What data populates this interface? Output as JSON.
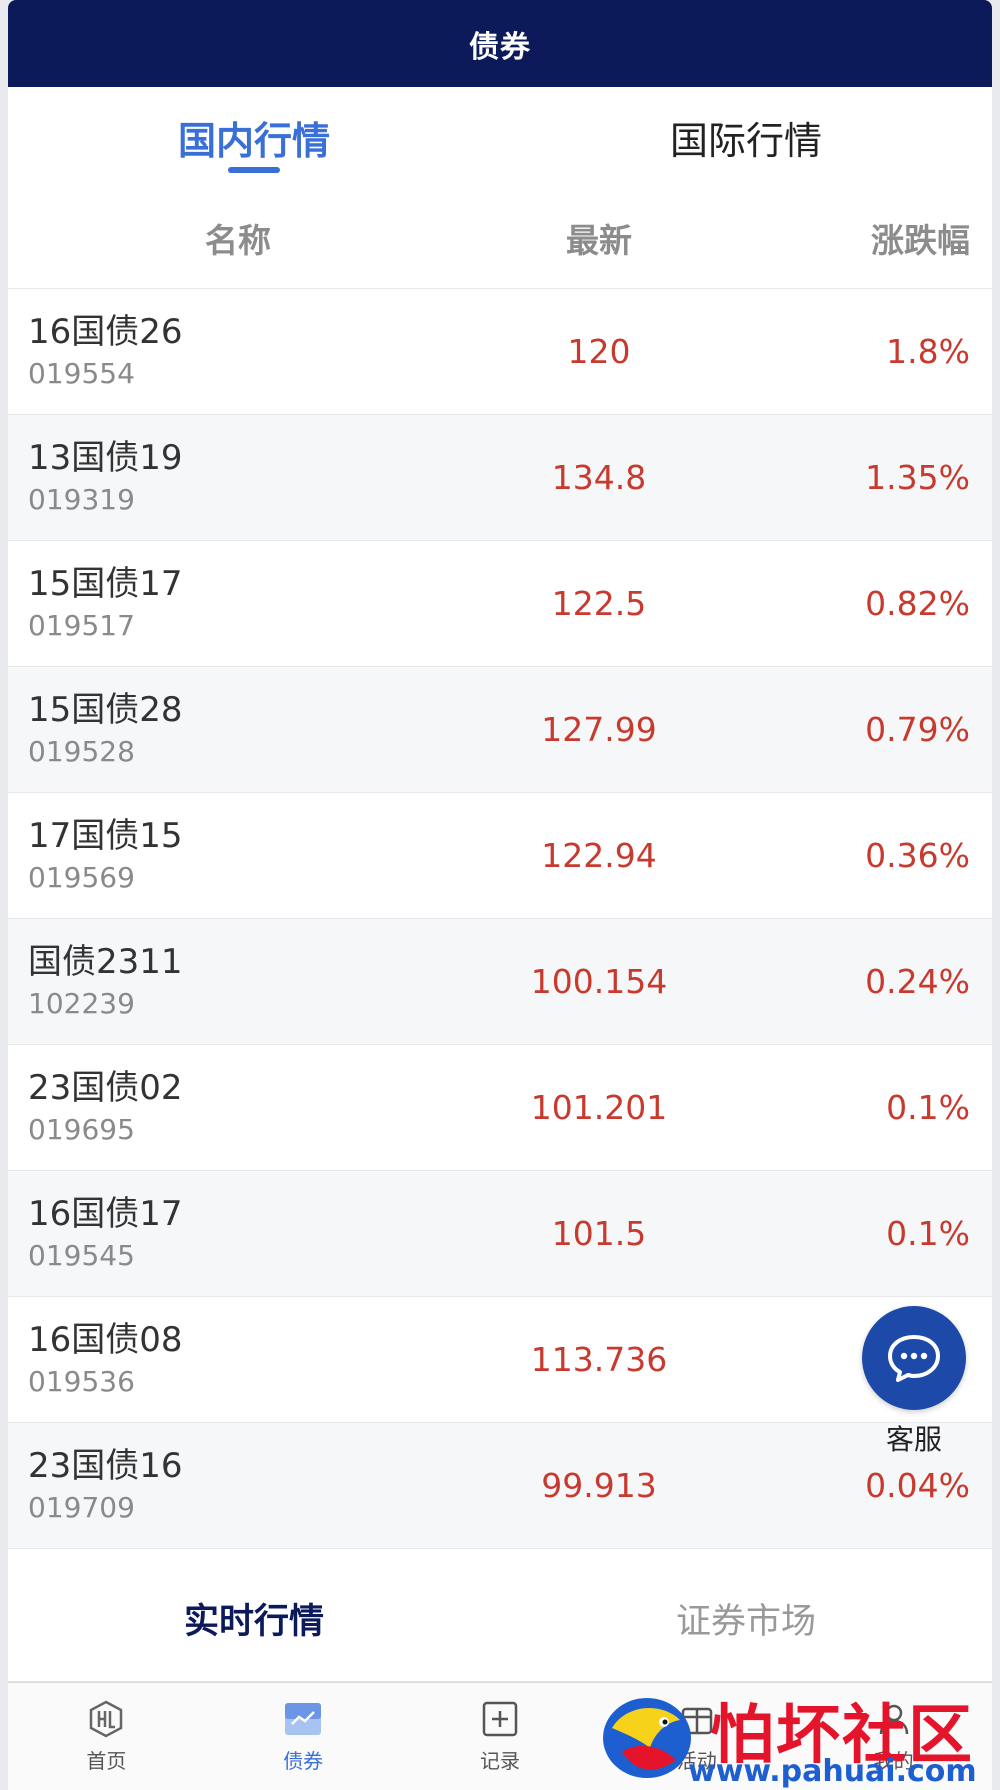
{
  "header": {
    "title": "债券"
  },
  "tabs": [
    {
      "label": "国内行情",
      "active": true
    },
    {
      "label": "国际行情",
      "active": false
    }
  ],
  "columns": {
    "name": "名称",
    "price": "最新",
    "change": "涨跌幅"
  },
  "rows": [
    {
      "name": "16国债26",
      "code": "019554",
      "price": "120",
      "change": "1.8%"
    },
    {
      "name": "13国债19",
      "code": "019319",
      "price": "134.8",
      "change": "1.35%"
    },
    {
      "name": "15国债17",
      "code": "019517",
      "price": "122.5",
      "change": "0.82%"
    },
    {
      "name": "15国债28",
      "code": "019528",
      "price": "127.99",
      "change": "0.79%"
    },
    {
      "name": "17国债15",
      "code": "019569",
      "price": "122.94",
      "change": "0.36%"
    },
    {
      "name": "国债2311",
      "code": "102239",
      "price": "100.154",
      "change": "0.24%"
    },
    {
      "name": "23国债02",
      "code": "019695",
      "price": "101.201",
      "change": "0.1%"
    },
    {
      "name": "16国债17",
      "code": "019545",
      "price": "101.5",
      "change": "0.1%"
    },
    {
      "name": "16国债08",
      "code": "019536",
      "price": "113.736",
      "change": ""
    },
    {
      "name": "23国债16",
      "code": "019709",
      "price": "99.913",
      "change": "0.04%"
    }
  ],
  "float_service": {
    "label": "客服",
    "icon": "chat-bubble-icon"
  },
  "subtabs": [
    {
      "label": "实时行情",
      "active": true
    },
    {
      "label": "证券市场",
      "active": false
    }
  ],
  "bottom_nav": [
    {
      "label": "首页",
      "icon": "hl-logo-icon",
      "active": false
    },
    {
      "label": "债券",
      "icon": "trend-chart-icon",
      "active": true
    },
    {
      "label": "记录",
      "icon": "plus-square-icon",
      "active": false
    },
    {
      "label": "活动",
      "icon": "activity-icon",
      "active": false
    },
    {
      "label": "我的",
      "icon": "user-icon",
      "active": false
    }
  ],
  "watermark": {
    "title": "怕坏社区",
    "url": "www.pahuai.com"
  },
  "colors": {
    "header_bg": "#0c1a59",
    "accent": "#3a6fd8",
    "up_red": "#c8392e"
  }
}
